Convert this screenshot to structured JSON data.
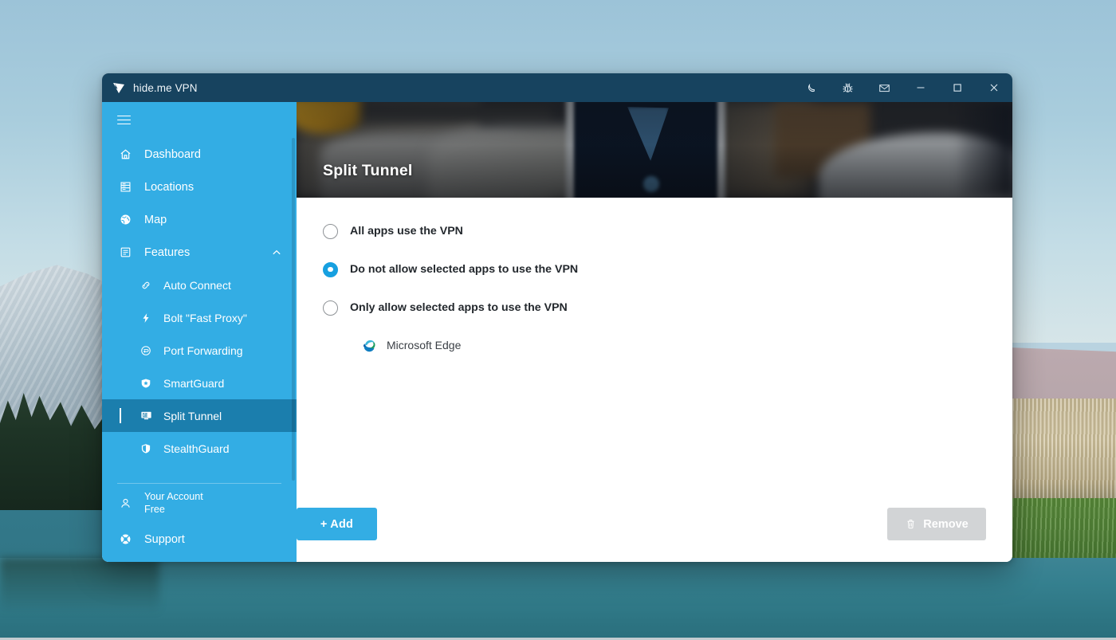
{
  "window": {
    "title": "hide.me VPN",
    "logo_icon": "hideme-logo-icon",
    "controls": [
      {
        "name": "dark-mode-icon",
        "label": "Dark mode"
      },
      {
        "name": "bug-report-icon",
        "label": "Report a bug"
      },
      {
        "name": "mail-icon",
        "label": "Contact"
      },
      {
        "name": "minimize-icon",
        "label": "Minimize"
      },
      {
        "name": "maximize-icon",
        "label": "Maximize"
      },
      {
        "name": "close-icon",
        "label": "Close"
      }
    ]
  },
  "sidebar": {
    "menu_icon": "hamburger-icon",
    "accent_color": "#33ade4",
    "active_color": "#1b7ead",
    "items": [
      {
        "label": "Dashboard",
        "icon": "home-icon",
        "level": 0,
        "active": false
      },
      {
        "label": "Locations",
        "icon": "server-icon",
        "level": 0,
        "active": false
      },
      {
        "label": "Map",
        "icon": "globe-icon",
        "level": 0,
        "active": false
      },
      {
        "label": "Features",
        "icon": "list-icon",
        "level": 0,
        "active": false,
        "expanded": true,
        "chevron": "chevron-up-icon"
      },
      {
        "label": "Auto Connect",
        "icon": "link-icon",
        "level": 1,
        "active": false
      },
      {
        "label": "Bolt \"Fast Proxy\"",
        "icon": "bolt-icon",
        "level": 1,
        "active": false
      },
      {
        "label": "Port Forwarding",
        "icon": "port-forwarding-icon",
        "level": 1,
        "active": false
      },
      {
        "label": "SmartGuard",
        "icon": "smartguard-icon",
        "level": 1,
        "active": false
      },
      {
        "label": "Split Tunnel",
        "icon": "monitor-icon",
        "level": 1,
        "active": true
      },
      {
        "label": "StealthGuard",
        "icon": "shield-icon",
        "level": 1,
        "active": false
      }
    ],
    "account": {
      "icon": "user-icon",
      "title": "Your Account",
      "plan": "Free"
    },
    "support": {
      "icon": "lifebuoy-icon",
      "label": "Support"
    }
  },
  "banner": {
    "title": "Split Tunnel"
  },
  "main": {
    "options": [
      {
        "label": "All apps use the VPN",
        "selected": false
      },
      {
        "label": "Do not allow selected apps to use the VPN",
        "selected": true
      },
      {
        "label": "Only allow selected apps to use the VPN",
        "selected": false
      }
    ],
    "apps": [
      {
        "name": "Microsoft Edge",
        "icon": "microsoft-edge-icon"
      }
    ],
    "add_button": {
      "label": "+ Add",
      "color": "#33ade4"
    },
    "remove_button": {
      "label": "Remove",
      "icon": "trash-icon",
      "disabled": true,
      "color": "#d2d4d6"
    }
  }
}
